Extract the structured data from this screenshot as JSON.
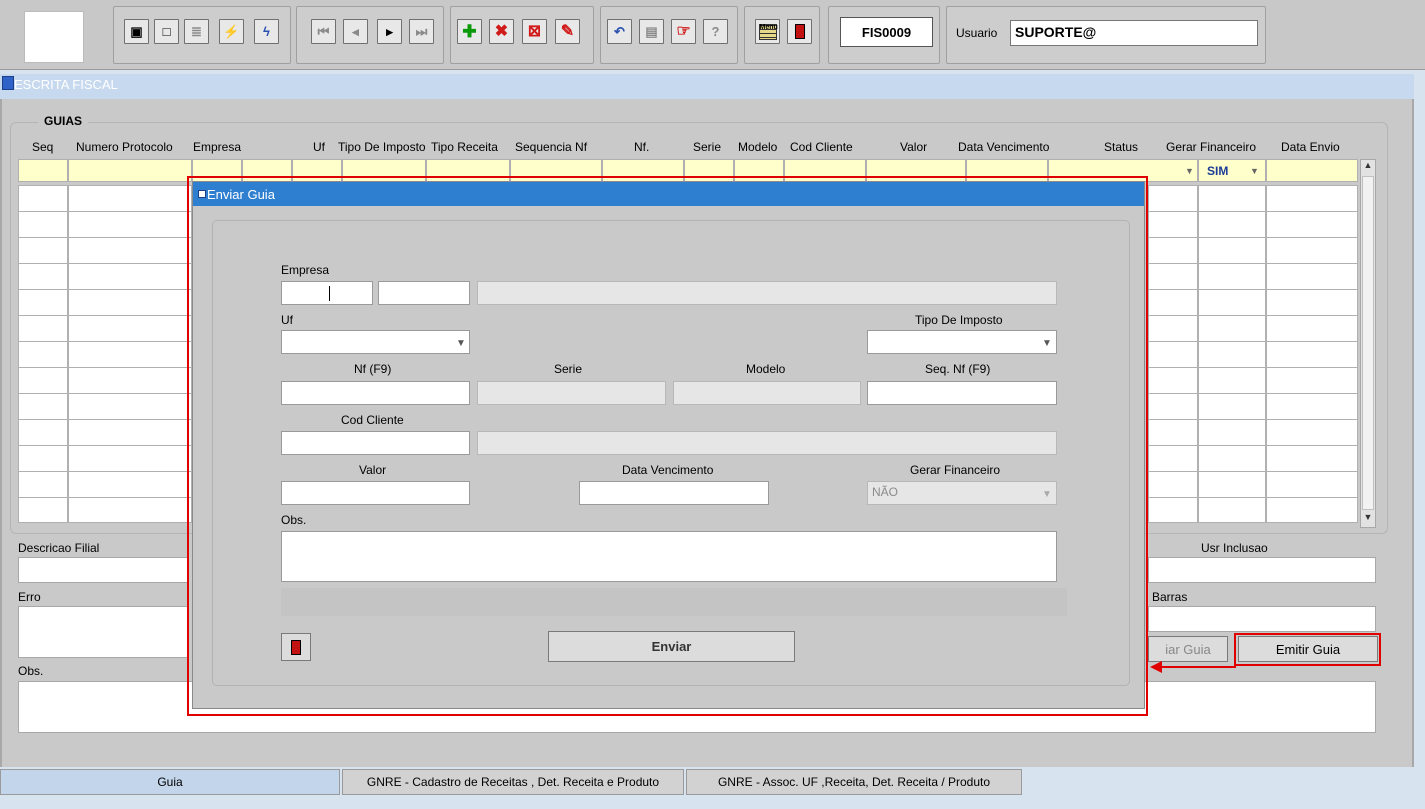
{
  "toolbar": {
    "form_code": "FIS0009",
    "usuario_label": "Usuario",
    "usuario_value": "SUPORTE@",
    "help_glyph": "?",
    "menu_glyph": "Menu"
  },
  "window": {
    "title": "ESCRITA FISCAL"
  },
  "guias": {
    "title": "GUIAS",
    "columns": [
      "Seq",
      "Numero Protocolo",
      "Empresa",
      "Uf",
      "Tipo De Imposto",
      "Tipo Receita",
      "Sequencia Nf",
      "Nf.",
      "Serie",
      "Modelo",
      "Cod Cliente",
      "Valor",
      "Data Vencimento",
      "Status",
      "Gerar Financeiro",
      "Data Envio"
    ],
    "first_row_gerar_financeiro": "SIM"
  },
  "details": {
    "descricao_filial_label": "Descricao Filial",
    "usr_inclusao_label": "Usr Inclusao",
    "erro_label": "Erro",
    "barras_label": "Barras",
    "obs_label": "Obs.",
    "enviar_guia_label": "iar Guia",
    "emitir_guia_label": "Emitir Guia"
  },
  "tabs": [
    {
      "label": "Guia"
    },
    {
      "label": "GNRE - Cadastro de Receitas , Det. Receita e Produto"
    },
    {
      "label": "GNRE - Assoc. UF ,Receita, Det. Receita / Produto"
    }
  ],
  "dialog": {
    "title": "Enviar Guia",
    "empresa_label": "Empresa",
    "uf_label": "Uf",
    "tipo_imposto_label": "Tipo De Imposto",
    "nf_label": "Nf (F9)",
    "serie_label": "Serie",
    "modelo_label": "Modelo",
    "seq_nf_label": "Seq. Nf (F9)",
    "cod_cliente_label": "Cod Cliente",
    "valor_label": "Valor",
    "data_vencimento_label": "Data Vencimento",
    "gerar_financeiro_label": "Gerar Financeiro",
    "gerar_financeiro_value": "NÃO",
    "obs_label": "Obs.",
    "enviar_label": "Enviar"
  },
  "colors": {
    "accent_blue": "#2f7fd0",
    "highlight_red": "#e00000",
    "row_yellow": "#ffffcc"
  }
}
